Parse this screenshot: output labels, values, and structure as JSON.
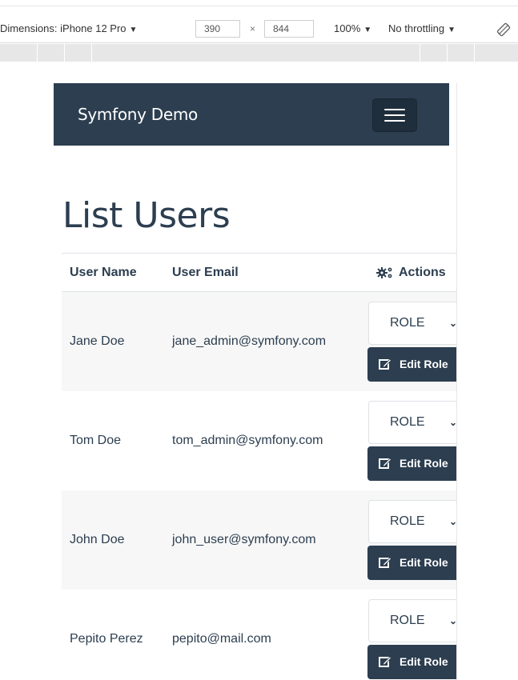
{
  "devtools": {
    "dimensions_label": "Dimensions: iPhone 12 Pro",
    "width_value": "390",
    "times": "×",
    "height_value": "844",
    "zoom": "100%",
    "throttling": "No throttling",
    "caret": "▼"
  },
  "navbar": {
    "brand": "Symfony Demo",
    "toggler_icon": "hamburger-icon"
  },
  "page": {
    "title": "List Users"
  },
  "table": {
    "headers": {
      "user_name": "User Name",
      "user_email": "User Email",
      "actions": "Actions",
      "actions_icon": "gears-icon"
    },
    "rows": [
      {
        "name": "Jane Doe",
        "email": "jane_admin@symfony.com",
        "role": "ROLE",
        "edit": "Edit Role"
      },
      {
        "name": "Tom Doe",
        "email": "tom_admin@symfony.com",
        "role": "ROLE",
        "edit": "Edit Role"
      },
      {
        "name": "John Doe",
        "email": "john_user@symfony.com",
        "role": "ROLE",
        "edit": "Edit Role"
      },
      {
        "name": "Pepito Perez",
        "email": "pepito@mail.com",
        "role": "ROLE",
        "edit": "Edit Role"
      }
    ]
  },
  "colors": {
    "navbar_bg": "#2c3e50",
    "text_primary": "#2c3e50",
    "row_stripe": "#f7f7f7"
  }
}
